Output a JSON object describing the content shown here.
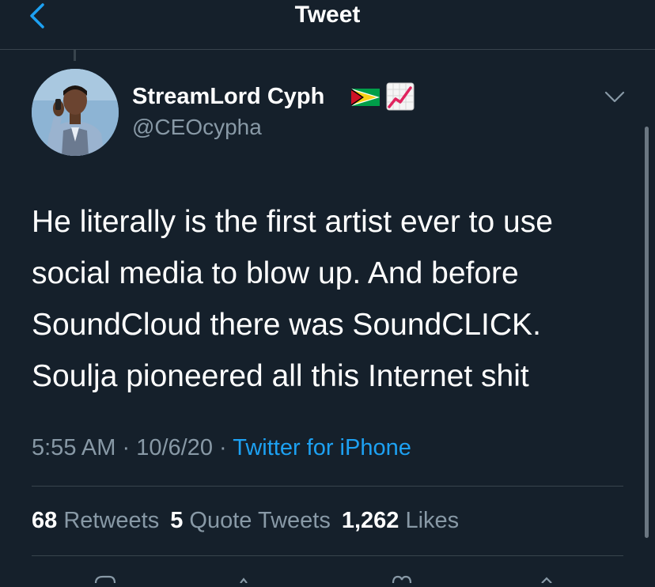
{
  "header": {
    "title": "Tweet",
    "back_icon": "chevron-left-icon"
  },
  "author": {
    "display_name": "StreamLord Cyph",
    "handle": "@CEOcypha",
    "name_emojis": [
      "guyana-flag-icon",
      "chart-increasing-icon"
    ]
  },
  "tweet": {
    "lines": [
      "He literally is the first artist ever to use",
      "social media to blow up. And before",
      "SoundCloud there was SoundCLICK.",
      "Soulja pioneered all this Internet shit"
    ]
  },
  "meta": {
    "time": "5:55 AM",
    "separator": " · ",
    "date": "10/6/20",
    "source": "Twitter for iPhone"
  },
  "stats": {
    "retweets_count": "68",
    "retweets_label": "Retweets",
    "quotes_count": "5",
    "quotes_label": "Quote Tweets",
    "likes_count": "1,262",
    "likes_label": "Likes"
  },
  "colors": {
    "background": "#15202b",
    "accent": "#1da1f2",
    "secondary_text": "#8899a6",
    "divider": "#38444d"
  }
}
